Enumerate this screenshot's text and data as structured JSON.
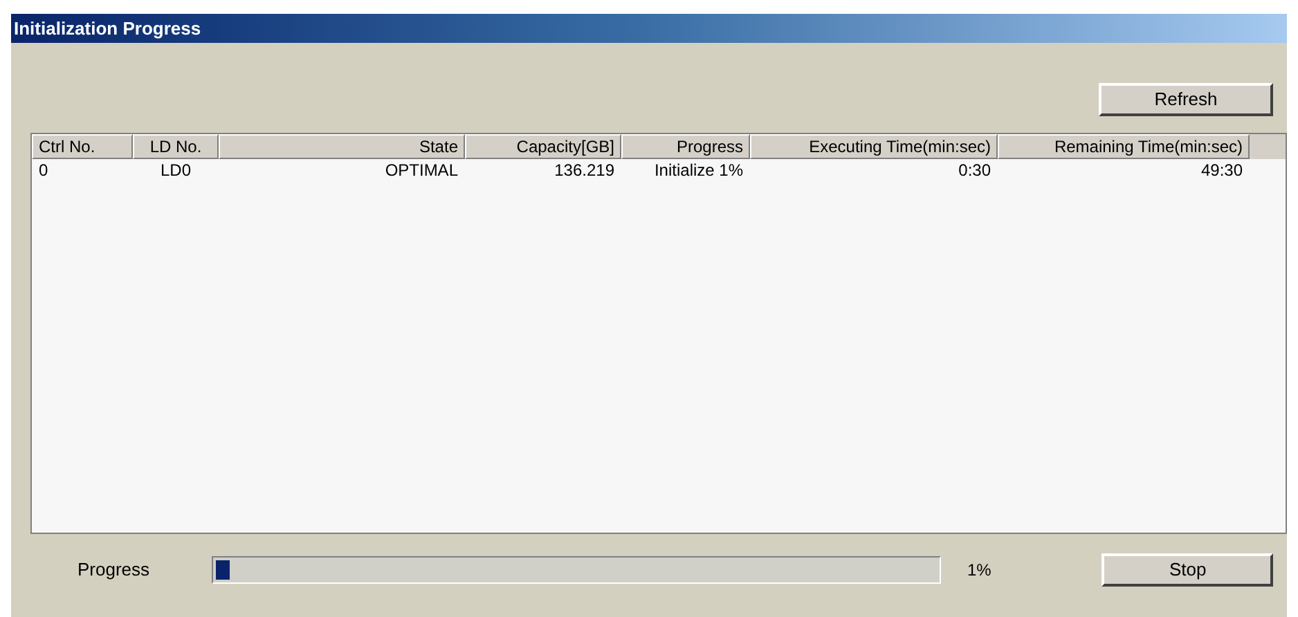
{
  "window": {
    "title": "Initialization Progress"
  },
  "refresh_button": "Refresh",
  "table": {
    "columns": [
      "Ctrl No.",
      "LD No.",
      "State",
      "Capacity[GB]",
      "Progress",
      "Executing Time(min:sec)",
      "Remaining Time(min:sec)"
    ],
    "rows": [
      [
        "0",
        "LD0",
        "OPTIMAL",
        "136.219",
        "Initialize 1%",
        "0:30",
        "49:30"
      ]
    ]
  },
  "progress": {
    "label": "Progress",
    "level": 0.02,
    "reading": "1%"
  },
  "stop_button": "Stop"
}
